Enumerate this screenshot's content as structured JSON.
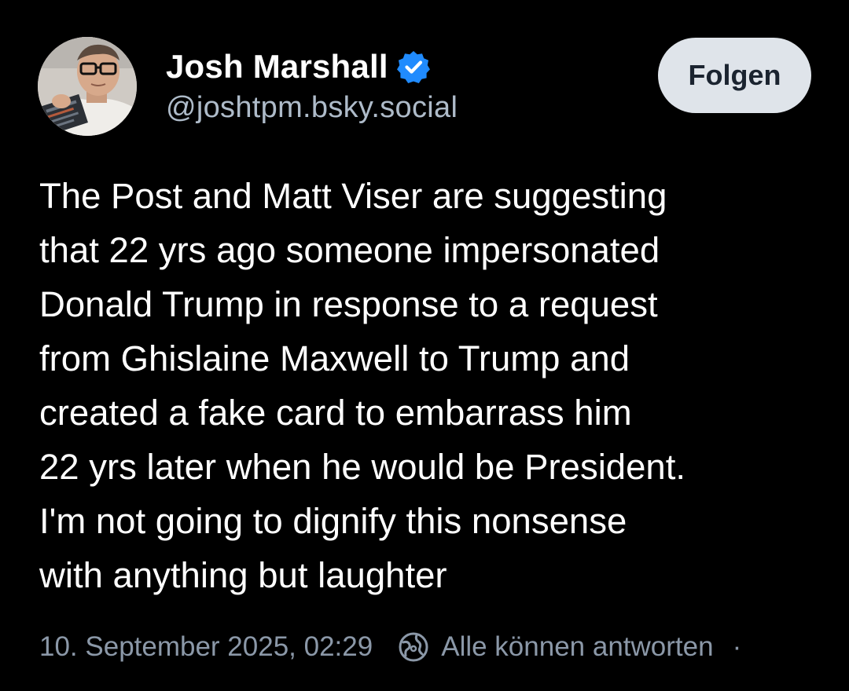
{
  "author": {
    "display_name": "Josh Marshall",
    "handle": "@joshtpm.bsky.social",
    "verified_color": "#208bfe"
  },
  "actions": {
    "follow_label": "Folgen"
  },
  "post": {
    "lines": [
      "The Post and Matt Viser are suggesting",
      "that 22 yrs ago someone impersonated",
      "Donald Trump in response to a request",
      "from Ghislaine Maxwell to Trump and",
      "created a fake card to embarrass him",
      "22 yrs later when he would be President.",
      "I'm not going to dignify this nonsense",
      "with anything but laughter"
    ]
  },
  "meta": {
    "timestamp": "10. September 2025, 02:29",
    "reply_setting_label": "Alle können antworten",
    "separator": "·"
  },
  "theme": {
    "background": "#000000",
    "text": "#ffffff",
    "muted": "#8b98a8",
    "handle": "#aebbc9",
    "button_bg": "#dfe4ea"
  }
}
